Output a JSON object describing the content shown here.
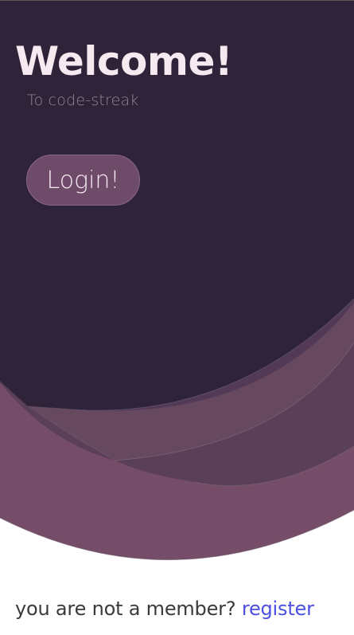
{
  "header": {
    "title": "Welcome!",
    "subtitle": "To code-streak"
  },
  "actions": {
    "login_label": "Login!"
  },
  "footer": {
    "prompt": "you are not a member?",
    "register_label": "register"
  },
  "colors": {
    "background_dark": "#2f233a",
    "wave_mid": "#523a57",
    "wave_light": "#66485f",
    "wave_bottom": "#764d69",
    "button": "#6e4b69",
    "link": "#4b4fe0"
  }
}
